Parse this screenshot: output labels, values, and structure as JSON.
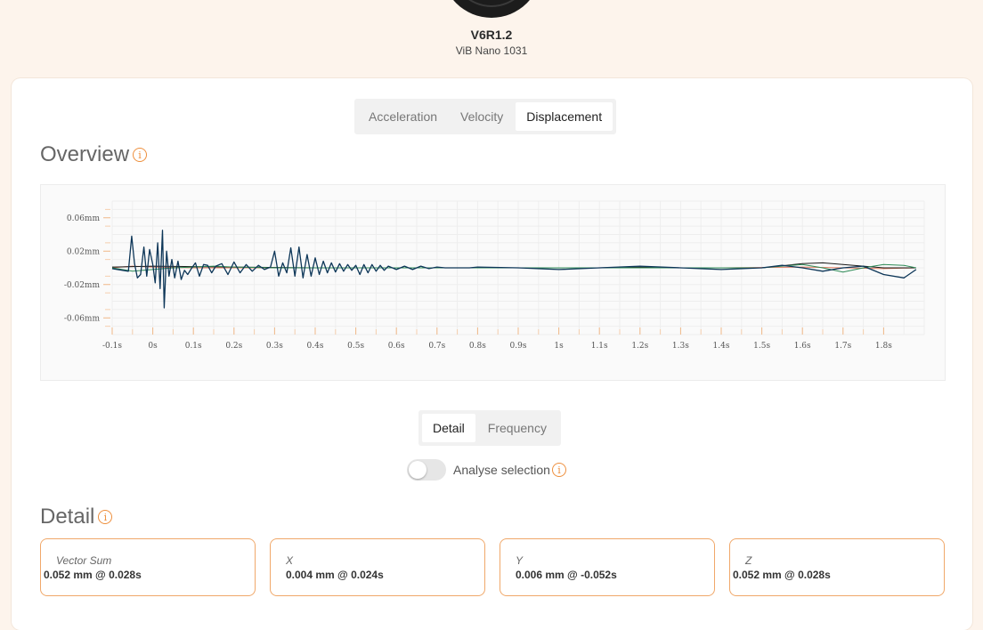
{
  "device": {
    "name": "V6R1.2",
    "model": "ViB Nano 1031"
  },
  "measure_tabs": [
    {
      "label": "Acceleration",
      "active": false
    },
    {
      "label": "Velocity",
      "active": false
    },
    {
      "label": "Displacement",
      "active": true
    }
  ],
  "overview": {
    "title": "Overview",
    "info_icon": "info-icon"
  },
  "view_tabs": [
    {
      "label": "Detail",
      "active": true
    },
    {
      "label": "Frequency",
      "active": false
    }
  ],
  "analyse": {
    "label": "Analyse selection",
    "enabled": false
  },
  "detail": {
    "title": "Detail",
    "stats": [
      {
        "label": "Vector Sum",
        "value": "0.052 mm @ 0.028s"
      },
      {
        "label": "X",
        "value": "0.004 mm @ 0.024s"
      },
      {
        "label": "Y",
        "value": "0.006 mm @ -0.052s"
      },
      {
        "label": "Z",
        "value": "0.052 mm @ 0.028s"
      }
    ]
  },
  "colors": {
    "accent": "#ee8f3d",
    "z": "#0d3658",
    "y": "#2e8b57",
    "x": "#e07a5f",
    "sum": "#1a1a1a"
  },
  "chart_data": {
    "type": "line",
    "xlabel": "",
    "ylabel": "",
    "xlim": [
      -0.1,
      1.9
    ],
    "ylim": [
      -0.08,
      0.08
    ],
    "x_ticks": [
      "-0.1s",
      "0s",
      "0.1s",
      "0.2s",
      "0.3s",
      "0.4s",
      "0.5s",
      "0.6s",
      "0.7s",
      "0.8s",
      "0.9s",
      "1s",
      "1.1s",
      "1.2s",
      "1.3s",
      "1.4s",
      "1.5s",
      "1.6s",
      "1.7s",
      "1.8s"
    ],
    "x_tick_values": [
      -0.1,
      0,
      0.1,
      0.2,
      0.3,
      0.4,
      0.5,
      0.6,
      0.7,
      0.8,
      0.9,
      1.0,
      1.1,
      1.2,
      1.3,
      1.4,
      1.5,
      1.6,
      1.7,
      1.8
    ],
    "y_ticks": [
      "0.06mm",
      "0.02mm",
      "-0.02mm",
      "-0.06mm"
    ],
    "y_tick_values": [
      0.06,
      0.02,
      -0.02,
      -0.06
    ],
    "series": [
      {
        "color": "#0d3658",
        "x": [
          -0.1,
          -0.06,
          -0.052,
          -0.045,
          -0.038,
          -0.03,
          -0.022,
          -0.015,
          -0.008,
          0.0,
          0.006,
          0.012,
          0.018,
          0.024,
          0.028,
          0.034,
          0.04,
          0.047,
          0.054,
          0.062,
          0.07,
          0.078,
          0.086,
          0.095,
          0.105,
          0.115,
          0.125,
          0.135,
          0.145,
          0.155,
          0.17,
          0.185,
          0.2,
          0.215,
          0.23,
          0.245,
          0.26,
          0.275,
          0.29,
          0.3,
          0.31,
          0.32,
          0.33,
          0.34,
          0.35,
          0.36,
          0.37,
          0.38,
          0.39,
          0.4,
          0.41,
          0.42,
          0.43,
          0.44,
          0.45,
          0.46,
          0.47,
          0.48,
          0.49,
          0.5,
          0.51,
          0.52,
          0.53,
          0.54,
          0.55,
          0.56,
          0.57,
          0.58,
          0.6,
          0.62,
          0.64,
          0.66,
          0.68,
          0.7,
          0.72,
          0.74,
          0.76,
          0.78,
          0.8,
          0.9,
          1.0,
          1.1,
          1.2,
          1.3,
          1.4,
          1.5,
          1.55,
          1.6,
          1.65,
          1.7,
          1.75,
          1.8,
          1.85,
          1.88
        ],
        "y": [
          -0.001,
          -0.004,
          0.038,
          0.005,
          -0.012,
          -0.008,
          0.025,
          -0.01,
          0.022,
          0.004,
          -0.018,
          0.03,
          -0.025,
          0.045,
          -0.048,
          0.02,
          -0.01,
          0.01,
          -0.012,
          0.008,
          -0.014,
          -0.003,
          -0.008,
          -0.001,
          0.006,
          -0.01,
          0.004,
          0.003,
          -0.006,
          0.002,
          0.005,
          -0.008,
          0.007,
          -0.006,
          0.004,
          -0.004,
          0.003,
          -0.002,
          0.001,
          0.02,
          -0.01,
          0.006,
          -0.006,
          0.024,
          -0.01,
          0.025,
          -0.012,
          0.016,
          -0.01,
          0.012,
          -0.008,
          0.008,
          -0.006,
          0.006,
          -0.005,
          0.005,
          -0.004,
          0.004,
          -0.003,
          0.003,
          -0.008,
          0.004,
          -0.006,
          0.004,
          -0.004,
          0.003,
          -0.003,
          0.002,
          -0.002,
          0.002,
          -0.002,
          0.002,
          -0.001,
          0.001,
          0.0,
          0.0,
          0.0,
          0.0,
          0.001,
          0.0,
          -0.002,
          0.0,
          0.002,
          0.0,
          -0.002,
          0.0,
          0.003,
          0.0,
          -0.004,
          0.0,
          0.002,
          -0.008,
          -0.012,
          -0.002
        ]
      },
      {
        "color": "#2e8b57",
        "x": [
          -0.1,
          -0.05,
          0.0,
          0.05,
          0.1,
          0.15,
          0.2,
          0.3,
          0.4,
          0.5,
          0.6,
          0.8,
          1.0,
          1.2,
          1.4,
          1.5,
          1.55,
          1.6,
          1.65,
          1.7,
          1.75,
          1.8,
          1.85,
          1.88
        ],
        "y": [
          0.0,
          -0.004,
          -0.002,
          0.0,
          0.001,
          0.002,
          0.001,
          0.0,
          0.0,
          0.0,
          0.0,
          0.0,
          0.0,
          0.0,
          0.0,
          0.0,
          0.002,
          0.004,
          0.0,
          -0.005,
          0.0,
          0.004,
          0.003,
          0.0
        ]
      },
      {
        "color": "#e07a5f",
        "x": [
          -0.1,
          -0.05,
          0.0,
          0.1,
          0.2,
          0.4,
          0.6,
          0.8,
          1.0,
          1.2,
          1.4,
          1.6,
          1.7,
          1.8,
          1.88
        ],
        "y": [
          0.0,
          0.002,
          0.001,
          0.0,
          0.0,
          0.0,
          0.0,
          0.0,
          0.0,
          0.0,
          0.0,
          0.001,
          0.0,
          -0.001,
          0.0
        ]
      },
      {
        "color": "#1a1a1a",
        "x": [
          -0.1,
          0.0,
          0.2,
          0.4,
          0.6,
          0.8,
          1.0,
          1.1,
          1.2,
          1.3,
          1.4,
          1.5,
          1.6,
          1.65,
          1.7,
          1.8,
          1.88
        ],
        "y": [
          0.001,
          0.002,
          0.001,
          0.0,
          0.0,
          0.0,
          0.0,
          0.0,
          0.001,
          0.0,
          0.0,
          0.0,
          0.005,
          0.006,
          0.004,
          0.0,
          0.0
        ]
      }
    ]
  }
}
